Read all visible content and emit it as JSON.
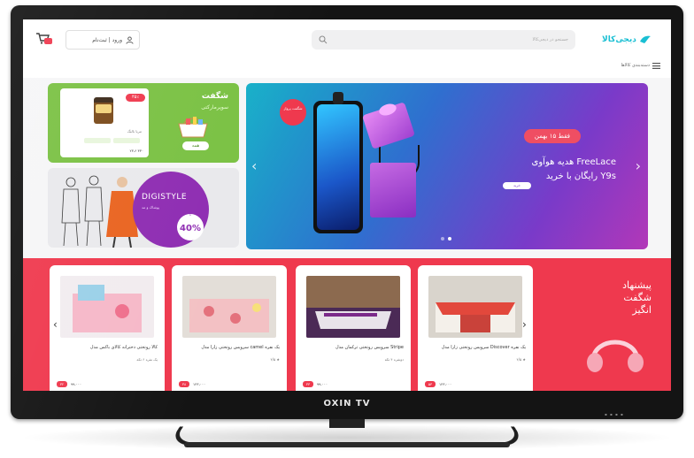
{
  "tv": {
    "brand": "OXIN TV"
  },
  "header": {
    "login_label": "ورود | ثبت‌نام",
    "search_placeholder": "جستجو در دیجی‌کالا",
    "logo_text": "دیجی‌کالا",
    "nav_label": "دسته‌بندی کالاها"
  },
  "promo_top": {
    "title": "شگفت",
    "subtitle": "سوپرمارکتی",
    "discount": "۴۵٪",
    "product_name": "مربا بالنگ",
    "prices": "۲۳،۶ ۳۳۰",
    "button": "همه"
  },
  "promo_bottom": {
    "brand_text": "DIGISTYLE",
    "sub_text": "پوشاک و مد",
    "badge_up": "تا",
    "badge_pct": "40%"
  },
  "slider": {
    "circle_text": "شگفت\nپرواز",
    "pill": "فقط ۱۵ بهمن",
    "headline": "هدیه هوآوی FreeLace",
    "subline": "رایگان با خرید Y9s",
    "button": "خرید"
  },
  "offers": {
    "title_line1": "پیشنهاد",
    "title_line2": "شگفت",
    "title_line3": "انگیز",
    "cards": [
      {
        "name": "سرویس روتختی زارا مدل Discover یک نفره",
        "sub": "۴/۵ ★",
        "disc": "۵۳",
        "price": "۱۲۳،۰۰۰"
      },
      {
        "name": "سرویس روتختی ترکمان مدل Stripe",
        "sub": "دونفره ۴ تکه",
        "disc": "۳۳",
        "price": "۹۹،۰۰۰"
      },
      {
        "name": "سرویس روتختی زارا مدل camel یک نفره",
        "sub": "۴/۵ ★",
        "disc": "۳۸",
        "price": "۱۲۳،۰۰۰"
      },
      {
        "name": "کالا روتختی دخترانه کالای باکس مدل",
        "sub": "یک نفره ۶ تکه",
        "disc": "۳۲",
        "price": "۹۹،۰۰۰"
      }
    ]
  },
  "colors": {
    "accent": "#ef394e",
    "brand": "#19bfd3",
    "green": "#7ac143"
  }
}
